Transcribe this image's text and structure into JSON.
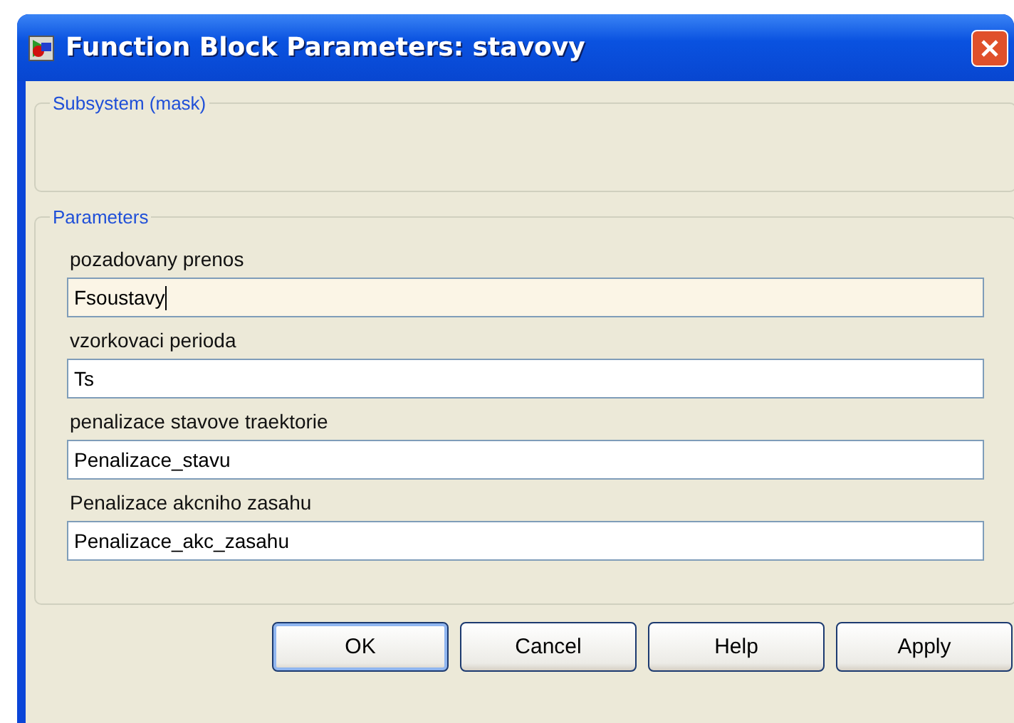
{
  "window": {
    "title": "Function Block Parameters: stavovy"
  },
  "groups": [
    {
      "legend": "Subsystem (mask)"
    },
    {
      "legend": "Parameters",
      "fields": [
        {
          "label": "pozadovany prenos",
          "value": "Fsoustavy",
          "focused": true
        },
        {
          "label": "vzorkovaci perioda",
          "value": "Ts",
          "focused": false
        },
        {
          "label": "penalizace stavove traektorie",
          "value": "Penalizace_stavu",
          "focused": false
        },
        {
          "label": "Penalizace akcniho zasahu",
          "value": "Penalizace_akc_zasahu",
          "focused": false
        }
      ]
    }
  ],
  "buttons": [
    {
      "label": "OK",
      "default": true
    },
    {
      "label": "Cancel",
      "default": false
    },
    {
      "label": "Help",
      "default": false
    },
    {
      "label": "Apply",
      "default": false
    }
  ]
}
